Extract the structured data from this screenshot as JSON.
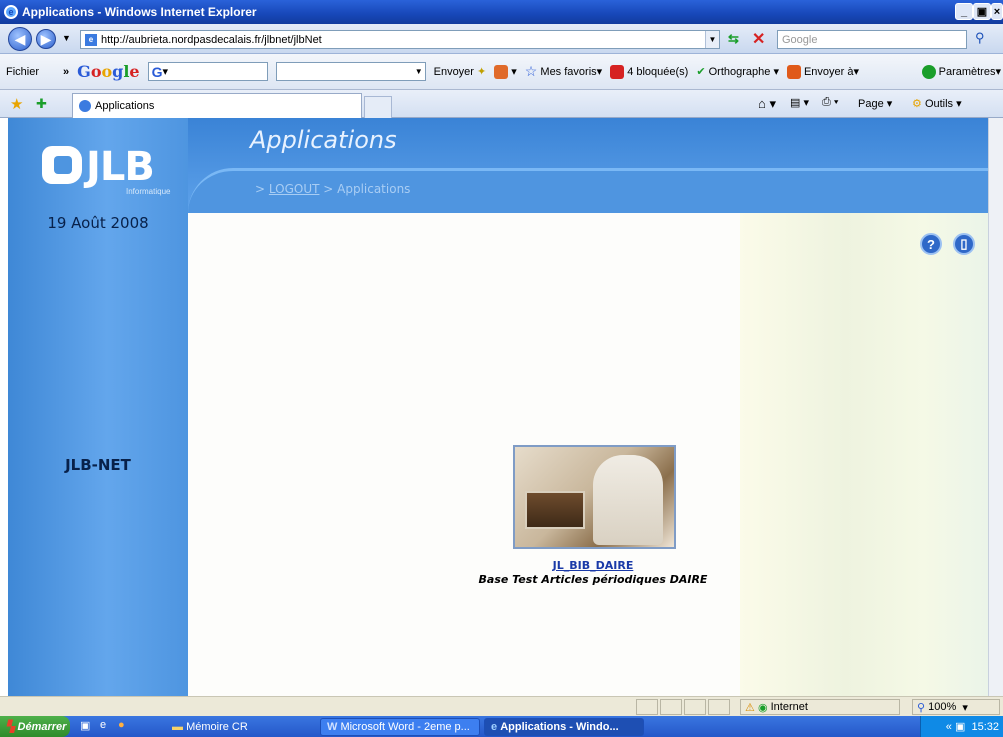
{
  "window": {
    "title": "Applications - Windows Internet Explorer"
  },
  "address": {
    "url": "http://aubrieta.nordpasdecalais.fr/jlbnet/jlbNet",
    "search_placeholder": "Google"
  },
  "google_toolbar": {
    "fichier": "Fichier",
    "chevron": "»",
    "google": "Google",
    "g_search": "G",
    "envoyer": "Envoyer",
    "mes_favoris": "Mes favoris",
    "bloquees": "4 bloquée(s)",
    "orthographe": "Orthographe",
    "envoyer_a": "Envoyer à",
    "parametres": "Paramètres"
  },
  "tabs": {
    "active": "Applications"
  },
  "command_bar": {
    "page": "Page",
    "outils": "Outils"
  },
  "page": {
    "logo_text": "JLB",
    "logo_sub": "Informatique",
    "date": "19 Août 2008",
    "app_name": "JLB-NET",
    "title": "Applications",
    "breadcrumb_prefix": "> ",
    "breadcrumb_logout": "LOGOUT",
    "breadcrumb_rest": " > Applications",
    "help_icon": "?",
    "app_link": "JL_BIB_DAIRE",
    "app_desc": "Base Test Articles périodiques DAIRE"
  },
  "status": {
    "zone": "Internet",
    "zoom": "100%"
  },
  "taskbar": {
    "start": "Démarrer",
    "tasks": [
      "Mémoire CR",
      "Microsoft Word - 2eme p...",
      "Applications - Windo..."
    ],
    "clock": "15:32"
  }
}
